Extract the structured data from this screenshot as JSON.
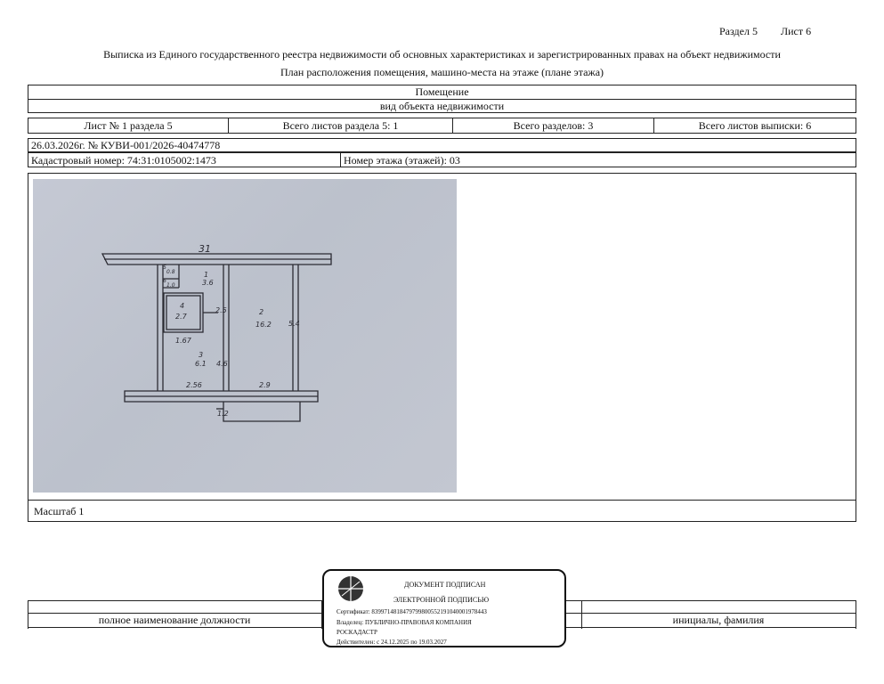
{
  "header": {
    "section": "Раздел 5",
    "sheet": "Лист 6"
  },
  "title": {
    "line1": "Выписка из Единого государственного реестра недвижимости об основных характеристиках и зарегистрированных правах на объект недвижимости",
    "line2": "План расположения помещения, машино-места на этаже (плане этажа)"
  },
  "object": {
    "type": "Помещение",
    "type_caption": "вид объекта недвижимости"
  },
  "sheets_row": {
    "sheet_no": "Лист № 1 раздела 5",
    "total_section_sheets": "Всего листов раздела 5: 1",
    "total_sections": "Всего разделов: 3",
    "total_extract_sheets": "Всего листов выписки: 6"
  },
  "doc": {
    "date_number": "26.03.2026г. № КУВИ-001/2026-40474778",
    "cadastral": "Кадастровый номер: 74:31:0105002:1473",
    "floor": "Номер этажа (этажей): 03"
  },
  "plan": {
    "street_label": "31",
    "rooms": [
      {
        "no": "1",
        "area": "3.6"
      },
      {
        "no": "2",
        "area": "16.2"
      },
      {
        "no": "3",
        "area": "6.1"
      },
      {
        "no": "4",
        "area": "2.7"
      },
      {
        "no": "5",
        "area": "0.8"
      },
      {
        "no": "6",
        "area": "1.0"
      }
    ],
    "dims": [
      "1.67",
      "2.56",
      "2.9",
      "2.5",
      "5.4",
      "4.6",
      "1.2"
    ]
  },
  "scale": "Масштаб 1",
  "signature": {
    "position_caption": "полное наименование должности",
    "name_caption": "инициалы, фамилия"
  },
  "stamp": {
    "line1": "ДОКУМЕНТ ПОДПИСАН",
    "line2": "ЭЛЕКТРОННОЙ ПОДПИСЬЮ",
    "certificate": "Сертификат: 839971481847979980055219104000197844З",
    "owner": "Владелец: ПУБЛИЧНО-ПРАВОВАЯ КОМПАНИЯ",
    "owner2": "РОСКАДАСТР",
    "valid": "Действителен: с 24.12.2025 по 19.03.2027"
  }
}
